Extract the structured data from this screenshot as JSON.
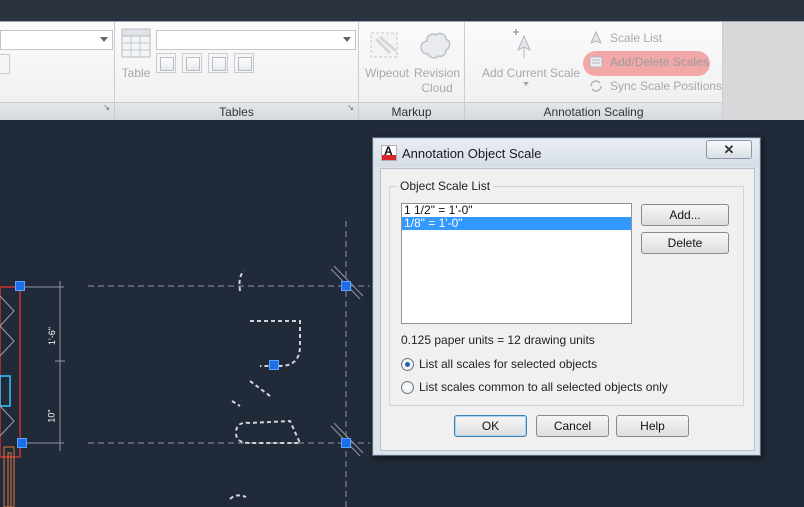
{
  "ribbon": {
    "tables_panel": {
      "title": "Tables",
      "table_button_label": "Table"
    },
    "markup_panel": {
      "title": "Markup",
      "wipeout_label": "Wipeout",
      "revision_cloud_label_line1": "Revision",
      "revision_cloud_label_line2": "Cloud"
    },
    "annotation_scaling_panel": {
      "title": "Annotation Scaling",
      "add_current_scale_label": "Add Current Scale",
      "scale_list_label": "Scale List",
      "add_delete_scales_label": "Add/Delete Scales",
      "sync_scale_positions_label": "Sync Scale Positions"
    },
    "highlight_color": "#f29a9a"
  },
  "drawing": {
    "dimension_texts": [
      "1'-6\"",
      "10\""
    ],
    "background_color": "#212a38",
    "grip_color": "#1c6fe8"
  },
  "dialog": {
    "title": "Annotation Object Scale",
    "close_glyph": "✕",
    "group_label": "Object Scale List",
    "scales": [
      {
        "label": "1 1/2\" = 1'-0\"",
        "selected": false
      },
      {
        "label": "1/8\" = 1'-0\"",
        "selected": true
      }
    ],
    "add_button": "Add...",
    "delete_button": "Delete",
    "units_text": "0.125 paper units = 12 drawing units",
    "radio_all_label": "List all scales for selected objects",
    "radio_common_label": "List scales common to all selected objects only",
    "radio_selected": "all",
    "ok_button": "OK",
    "cancel_button": "Cancel",
    "help_button": "Help"
  }
}
